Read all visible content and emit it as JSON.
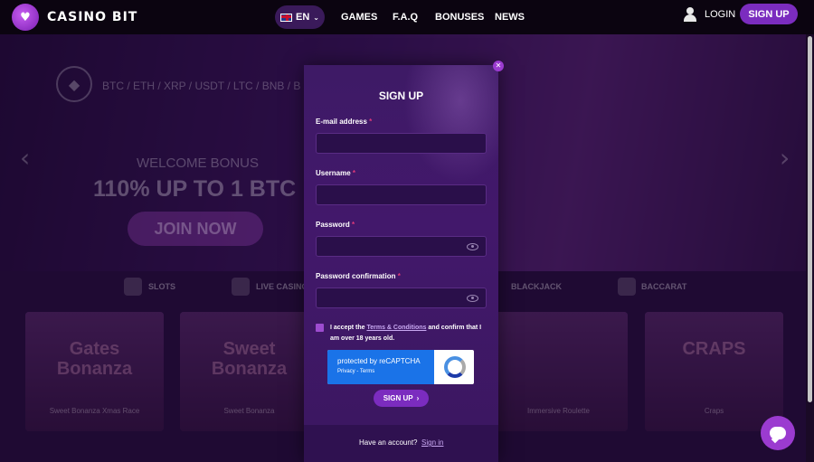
{
  "header": {
    "logo_text": "CASINO BIT",
    "lang": "EN",
    "nav": [
      "GAMES",
      "F.A.Q",
      "BONUSES",
      "NEWS"
    ],
    "login": "LOGIN",
    "signup": "SIGN UP"
  },
  "hero": {
    "crypto_list": "BTC / ETH / XRP / USDT / LTC / BNB / B",
    "welcome": "WELCOME BONUS",
    "bonus": "110% UP TO 1 BTC",
    "join": "JOIN NOW"
  },
  "categories": [
    "SLOTS",
    "LIVE CASINO",
    "BLACKJACK",
    "BACCARAT"
  ],
  "games": [
    {
      "art": "Gates Bonanza",
      "title": "Sweet Bonanza Xmas Race"
    },
    {
      "art": "Sweet Bonanza",
      "title": "Sweet Bonanza"
    },
    {
      "art": "",
      "title": "Immersive Roulette"
    },
    {
      "art": "CRAPS",
      "title": "Craps"
    }
  ],
  "modal": {
    "title": "SIGN UP",
    "email_label": "E-mail address",
    "username_label": "Username",
    "password_label": "Password",
    "password_confirm_label": "Password confirmation",
    "required_mark": "*",
    "terms_prefix": "I accept the",
    "terms_link": "Terms & Conditions",
    "terms_suffix": "and confirm that I am over 18 years old.",
    "recaptcha_text": "protected by reCAPTCHA",
    "recaptcha_links": "Privacy - Terms",
    "submit": "SIGN UP",
    "footer_text": "Have an account?",
    "footer_link": "Sign in"
  },
  "colors": {
    "accent": "#7b2cbf",
    "modal_bg": "#3e1a66",
    "header_bg": "#0b0410"
  }
}
